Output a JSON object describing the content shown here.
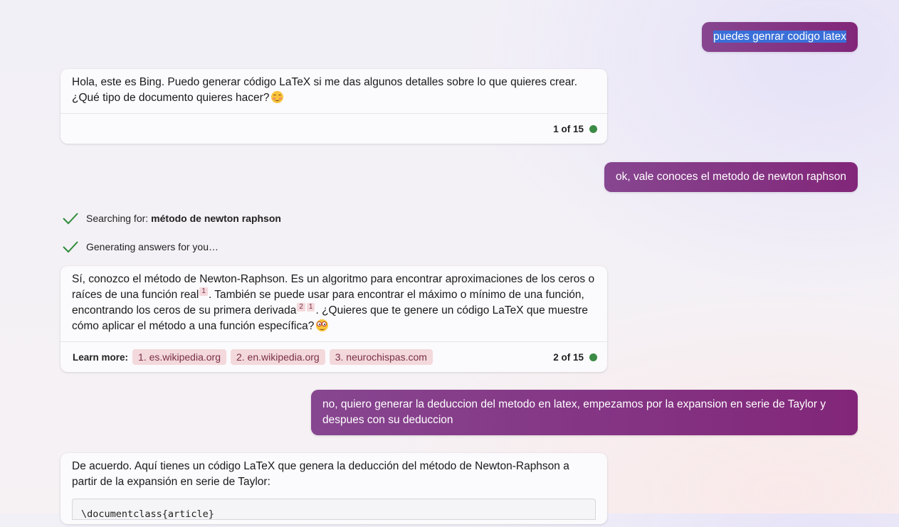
{
  "conversation": {
    "msg1_user": "puedes genrar codigo latex",
    "msg1_bot": {
      "text": "Hola, este es Bing. Puedo generar código LaTeX si me das algunos detalles sobre lo que quieres crear. ¿Qué tipo de documento quieres hacer?",
      "emoji_icon": "smiling-face-icon",
      "counter": "1 of 15"
    },
    "msg2_user": "ok, vale conoces el metodo de newton raphson",
    "search_status": {
      "searching_label": "Searching for:",
      "searching_query": "método de newton raphson",
      "generating_label": "Generating answers for you…"
    },
    "msg2_bot": {
      "text_part1": "Sí, conozco el método de Newton-Raphson. Es un algoritmo para encontrar aproximaciones de los ceros o raíces de una función real",
      "cite_a": "1",
      "text_part2": ". También se puede usar para encontrar el máximo o mínimo de una función, encontrando los ceros de su primera derivada",
      "cite_b": "2",
      "cite_c": "1",
      "text_part3": ". ¿Quieres que te genere un código LaTeX que muestre cómo aplicar el método a una función específica?",
      "emoji_icon": "nerd-face-icon",
      "learn_more_label": "Learn more:",
      "sources": [
        "1. es.wikipedia.org",
        "2. en.wikipedia.org",
        "3. neurochispas.com"
      ],
      "counter": "2 of 15"
    },
    "msg3_user": "no, quiero generar la deduccion del metodo en latex, empezamos por la expansion en serie de Taylor y despues con su deduccion",
    "msg3_bot": {
      "text": "De acuerdo. Aquí tienes un código LaTeX que genera la deducción del método de Newton-Raphson a partir de la expansión en serie de Taylor:",
      "code_first_line": "\\documentclass{article}"
    }
  },
  "colors": {
    "user_bubble_start": "#874690",
    "user_bubble_end": "#822679",
    "status_dot": "#3b8a45",
    "check_mark": "#2e8b3a",
    "source_chip_bg": "#f3d9dc"
  }
}
